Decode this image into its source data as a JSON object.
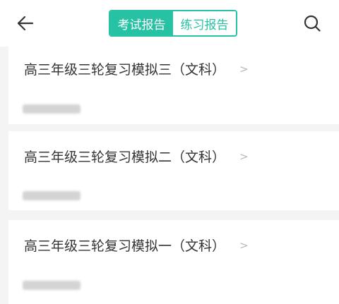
{
  "header": {
    "tabs": [
      {
        "label": "考试报告",
        "active": true
      },
      {
        "label": "练习报告",
        "active": false
      }
    ],
    "back_icon": "arrow-left-icon",
    "search_icon": "search-icon",
    "accent_color": "#27c2a4"
  },
  "reports": [
    {
      "title": "高三年级三轮复习模拟三（文科）",
      "chevron": ">"
    },
    {
      "title": "高三年级三轮复习模拟二（文科）",
      "chevron": ">"
    },
    {
      "title": "高三年级三轮复习模拟一（文科）",
      "chevron": ">"
    }
  ]
}
